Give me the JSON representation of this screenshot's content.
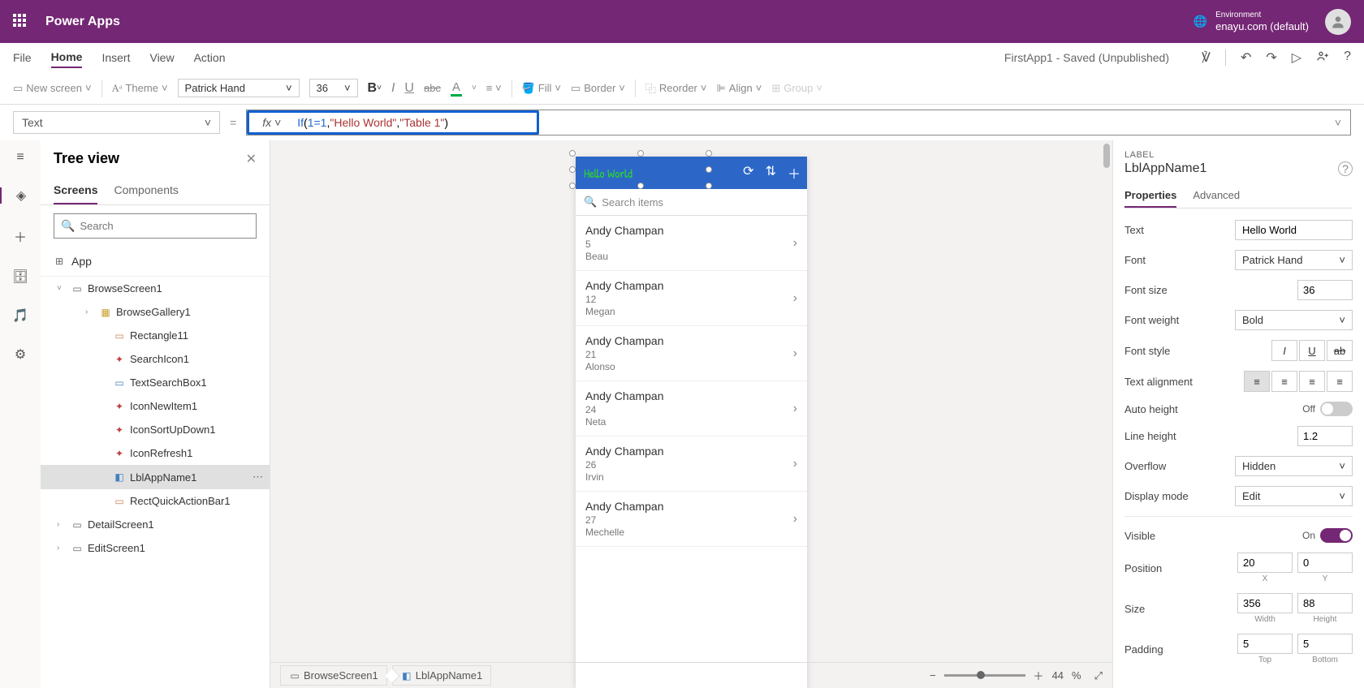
{
  "header": {
    "app_name": "Power Apps",
    "env_label": "Environment",
    "env_name": "enayu.com (default)"
  },
  "menu": {
    "items": [
      "File",
      "Home",
      "Insert",
      "View",
      "Action"
    ],
    "active": "Home",
    "app_status": "FirstApp1 - Saved (Unpublished)"
  },
  "toolbar": {
    "new_screen": "New screen",
    "theme": "Theme",
    "font": "Patrick Hand",
    "font_size": "36",
    "fill": "Fill",
    "border": "Border",
    "reorder": "Reorder",
    "align": "Align",
    "group": "Group"
  },
  "formula": {
    "property": "Text",
    "fx": "fx",
    "expr_if": "If",
    "expr_open": "(",
    "expr_cond": "1=1",
    "expr_c1": ", ",
    "expr_str1": "\"Hello World\"",
    "expr_c2": ", ",
    "expr_str2": "\"Table 1\"",
    "expr_close": ")"
  },
  "tree": {
    "title": "Tree view",
    "tabs": {
      "screens": "Screens",
      "components": "Components"
    },
    "search_placeholder": "Search",
    "app_root": "App",
    "browse_screen": "BrowseScreen1",
    "items": [
      {
        "name": "BrowseGallery1",
        "indent": "child",
        "icon": "gallery"
      },
      {
        "name": "Rectangle11",
        "indent": "grandchild",
        "icon": "rect"
      },
      {
        "name": "SearchIcon1",
        "indent": "grandchild",
        "icon": "ctrl"
      },
      {
        "name": "TextSearchBox1",
        "indent": "grandchild",
        "icon": "textbox"
      },
      {
        "name": "IconNewItem1",
        "indent": "grandchild",
        "icon": "ctrl"
      },
      {
        "name": "IconSortUpDown1",
        "indent": "grandchild",
        "icon": "ctrl"
      },
      {
        "name": "IconRefresh1",
        "indent": "grandchild",
        "icon": "ctrl"
      },
      {
        "name": "LblAppName1",
        "indent": "grandchild",
        "icon": "label",
        "selected": true
      },
      {
        "name": "RectQuickActionBar1",
        "indent": "grandchild",
        "icon": "rect"
      }
    ],
    "detail_screen": "DetailScreen1",
    "edit_screen": "EditScreen1"
  },
  "canvas": {
    "label_text": "Hello World",
    "search_placeholder": "Search items",
    "items": [
      {
        "name": "Andy Champan",
        "num": "5",
        "sub": "Beau"
      },
      {
        "name": "Andy Champan",
        "num": "12",
        "sub": "Megan"
      },
      {
        "name": "Andy Champan",
        "num": "21",
        "sub": "Alonso"
      },
      {
        "name": "Andy Champan",
        "num": "24",
        "sub": "Neta"
      },
      {
        "name": "Andy Champan",
        "num": "26",
        "sub": "Irvin"
      },
      {
        "name": "Andy Champan",
        "num": "27",
        "sub": "Mechelle"
      }
    ]
  },
  "props": {
    "section": "LABEL",
    "name": "LblAppName1",
    "tabs": {
      "properties": "Properties",
      "advanced": "Advanced"
    },
    "text_label": "Text",
    "text_value": "Hello World",
    "font_label": "Font",
    "font_value": "Patrick Hand",
    "fontsize_label": "Font size",
    "fontsize_value": "36",
    "fontweight_label": "Font weight",
    "fontweight_value": "Bold",
    "fontstyle_label": "Font style",
    "textalign_label": "Text alignment",
    "autoheight_label": "Auto height",
    "autoheight_value": "Off",
    "lineheight_label": "Line height",
    "lineheight_value": "1.2",
    "overflow_label": "Overflow",
    "overflow_value": "Hidden",
    "displaymode_label": "Display mode",
    "displaymode_value": "Edit",
    "visible_label": "Visible",
    "visible_value": "On",
    "position_label": "Position",
    "pos_x": "20",
    "pos_y": "0",
    "x_label": "X",
    "y_label": "Y",
    "size_label": "Size",
    "size_w": "356",
    "size_h": "88",
    "w_label": "Width",
    "h_label": "Height",
    "padding_label": "Padding",
    "pad_t": "5",
    "pad_b": "5",
    "t_label": "Top",
    "b_label": "Bottom"
  },
  "status": {
    "bc1": "BrowseScreen1",
    "bc2": "LblAppName1",
    "zoom": "44",
    "pct": "%"
  }
}
